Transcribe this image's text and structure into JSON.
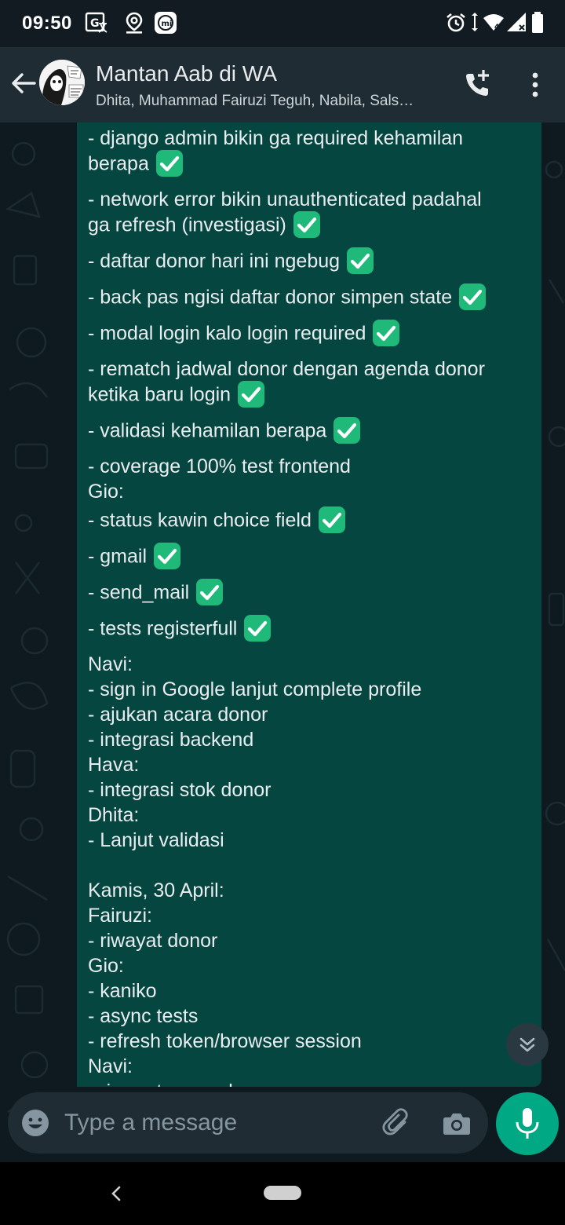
{
  "status_bar": {
    "time": "09:50",
    "icons": [
      "translate-icon",
      "location-icon",
      "mi-icon",
      "alarm-icon",
      "data-arrows-icon",
      "wifi-icon",
      "signal-icon",
      "battery-icon"
    ]
  },
  "header": {
    "title": "Mantan Aab di WA",
    "subtitle": "Dhita, Muhammad Fairuzi Teguh, Nabila, Sals…"
  },
  "message": {
    "lines": [
      {
        "text": "- django admin bikin ga required kehamilan",
        "check": false
      },
      {
        "text": "berapa",
        "check": true
      },
      {
        "text": "- network error bikin unauthenticated padahal",
        "check": false
      },
      {
        "text": "ga refresh (investigasi)",
        "check": true
      },
      {
        "text": "- daftar donor hari ini ngebug",
        "check": true
      },
      {
        "text": "- back pas ngisi daftar donor simpen state",
        "check": true
      },
      {
        "text": "- modal login kalo login required",
        "check": true
      },
      {
        "text": "- rematch jadwal donor dengan agenda donor",
        "check": false
      },
      {
        "text": "ketika baru login",
        "check": true
      },
      {
        "text": "- validasi kehamilan berapa",
        "check": true
      },
      {
        "text": "- coverage 100% test frontend",
        "check": false
      },
      {
        "text": "Gio:",
        "check": false
      },
      {
        "text": "- status kawin choice field",
        "check": true
      },
      {
        "text": "- gmail",
        "check": true
      },
      {
        "text": "- send_mail",
        "check": true
      },
      {
        "text": "- tests registerfull",
        "check": true
      },
      {
        "text": "Navi:",
        "check": false
      },
      {
        "text": "- sign in Google lanjut complete profile",
        "check": false
      },
      {
        "text": "- ajukan acara donor",
        "check": false
      },
      {
        "text": "- integrasi backend",
        "check": false
      },
      {
        "text": "Hava:",
        "check": false
      },
      {
        "text": "- integrasi stok donor",
        "check": false
      },
      {
        "text": "Dhita:",
        "check": false
      },
      {
        "text": "- Lanjut validasi",
        "check": false
      },
      {
        "text": "",
        "check": false
      },
      {
        "text": "Kamis, 30 April:",
        "check": false
      },
      {
        "text": "Fairuzi:",
        "check": false
      },
      {
        "text": "- riwayat donor",
        "check": false
      },
      {
        "text": "Gio:",
        "check": false
      },
      {
        "text": "- kaniko",
        "check": false
      },
      {
        "text": "- async tests",
        "check": false
      },
      {
        "text": "- refresh token/browser session",
        "check": false
      },
      {
        "text": "Navi:",
        "check": false
      },
      {
        "text": "- riwayat acara donor",
        "check": false
      }
    ]
  },
  "input": {
    "placeholder": "Type a message"
  },
  "colors": {
    "accent": "#00a884",
    "bubble": "#054740",
    "header": "#1f2c33",
    "check": "#1fb97a"
  }
}
